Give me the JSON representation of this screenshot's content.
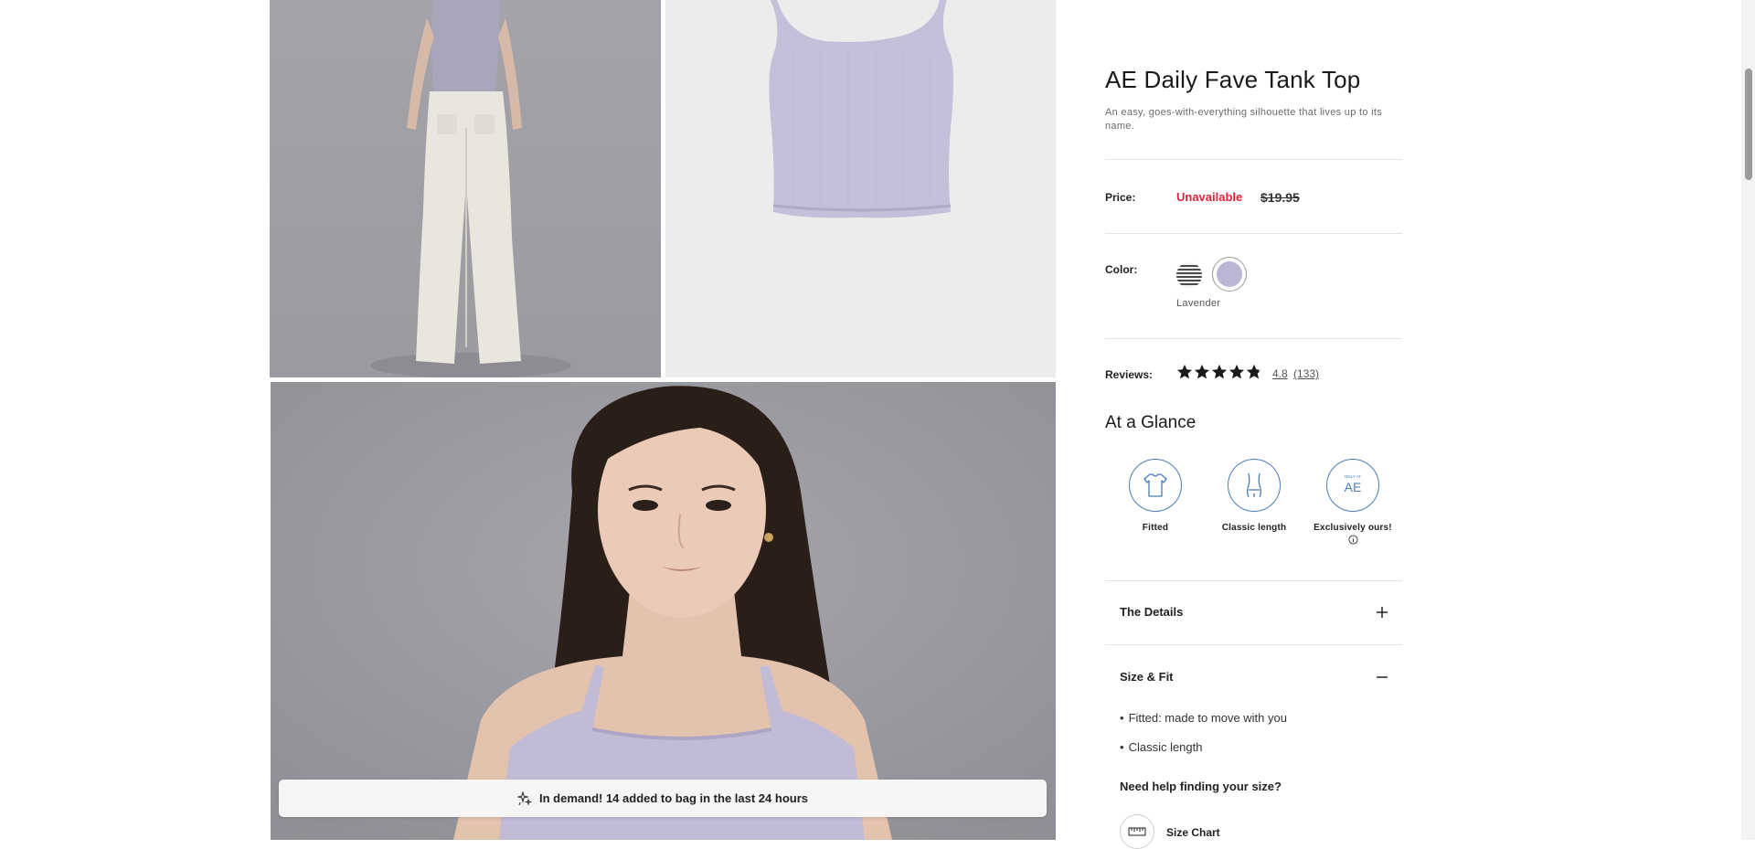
{
  "product": {
    "title": "AE Daily Fave Tank Top",
    "subtitle": "An easy, goes-with-everything silhouette that lives up to its name."
  },
  "price": {
    "label": "Price:",
    "status": "Unavailable",
    "original": "$19.95",
    "status_color": "#d7263d"
  },
  "color": {
    "label": "Color:",
    "selected_name": "Lavender",
    "swatches": [
      {
        "name": "stripe",
        "hex": "#4a4a4a"
      },
      {
        "name": "lavender",
        "hex": "#bdb5d6"
      }
    ]
  },
  "reviews": {
    "label": "Reviews:",
    "rating": "4.8",
    "count": "(133)",
    "stars_filled": 4.8,
    "stars_total": 5
  },
  "glance": {
    "title": "At a Glance",
    "items": [
      {
        "label": "Fitted",
        "icon": "tshirt-icon"
      },
      {
        "label": "Classic length",
        "icon": "torso-length-icon"
      },
      {
        "label": "Exclusively ours!",
        "icon": "only-at-ae-badge-icon",
        "badge_top": "ONLY AT",
        "badge_main": "AE"
      }
    ]
  },
  "accordions": {
    "details": {
      "title": "The Details",
      "state": "collapsed"
    },
    "size_fit": {
      "title": "Size & Fit",
      "state": "expanded"
    }
  },
  "size_fit": {
    "bullets": [
      "Fitted: made to move with you",
      "Classic length"
    ],
    "help_title": "Need help finding your size?",
    "size_chart_label": "Size Chart"
  },
  "demand_banner": {
    "text": "In demand! 14 added to bag in the last 24 hours"
  },
  "gallery": {
    "images": [
      "model-back-view",
      "tank-flat-lay",
      "model-portrait"
    ]
  },
  "colors": {
    "accent_blue": "#4a7db8",
    "star": "#1a1a1a"
  }
}
